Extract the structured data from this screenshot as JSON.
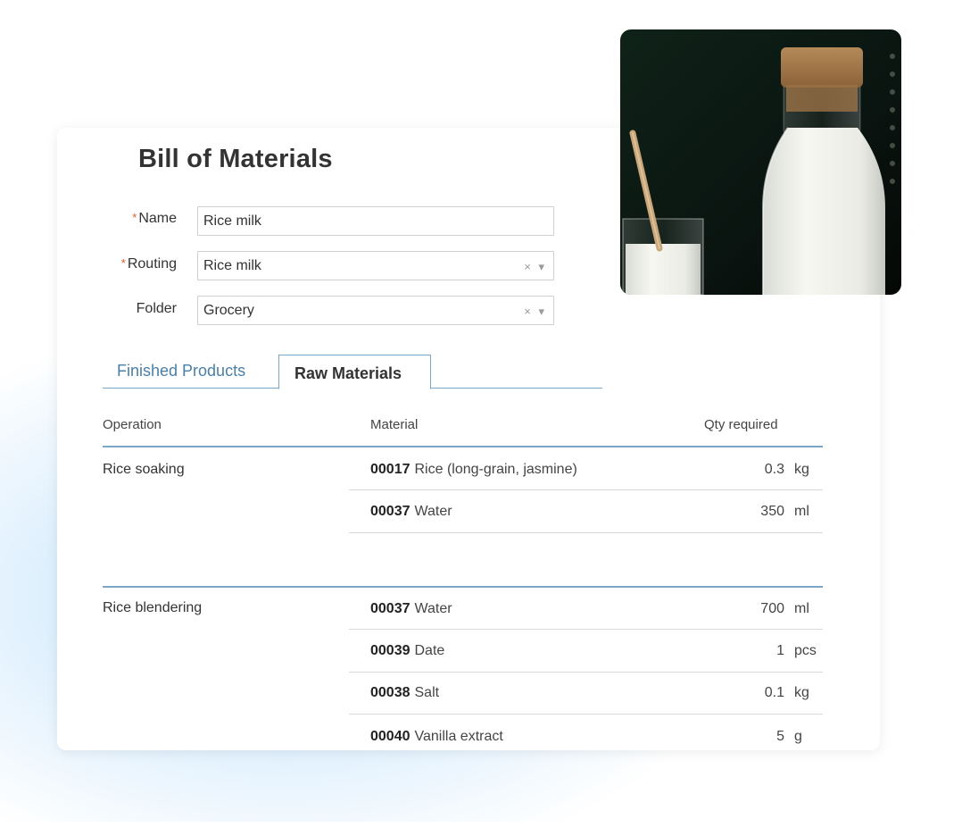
{
  "form": {
    "title": "Bill of Materials",
    "required_mark": "*",
    "name_label": "Name",
    "name_value": "Rice milk",
    "routing_label": "Routing",
    "routing_value": "Rice milk",
    "folder_label": "Folder",
    "folder_value": "Grocery",
    "clear_glyph": "×",
    "dropdown_glyph": "▾"
  },
  "tabs": [
    {
      "label": "Finished Products",
      "active": false
    },
    {
      "label": "Raw Materials",
      "active": true
    }
  ],
  "table": {
    "columns": [
      "Operation",
      "Material",
      "Qty required"
    ],
    "groups": [
      {
        "operation": "Rice soaking",
        "rows": [
          {
            "code": "00017",
            "name": "Rice (long-grain, jasmine)",
            "qty": "0.3",
            "unit": "kg"
          },
          {
            "code": "00037",
            "name": "Water",
            "qty": "350",
            "unit": "ml"
          }
        ]
      },
      {
        "operation": "Rice blendering",
        "rows": [
          {
            "code": "00037",
            "name": "Water",
            "qty": "700",
            "unit": "ml"
          },
          {
            "code": "00039",
            "name": "Date",
            "qty": "1",
            "unit": "pcs"
          },
          {
            "code": "00038",
            "name": "Salt",
            "qty": "0.1",
            "unit": "kg"
          },
          {
            "code": "00040",
            "name": "Vanilla extract",
            "qty": "5",
            "unit": "g"
          }
        ]
      }
    ]
  },
  "colors": {
    "accent": "#7aa7c8",
    "tab_link": "#4a7fa6",
    "required": "#e05a2b"
  },
  "image": {
    "icon": "milk-photo-icon"
  }
}
